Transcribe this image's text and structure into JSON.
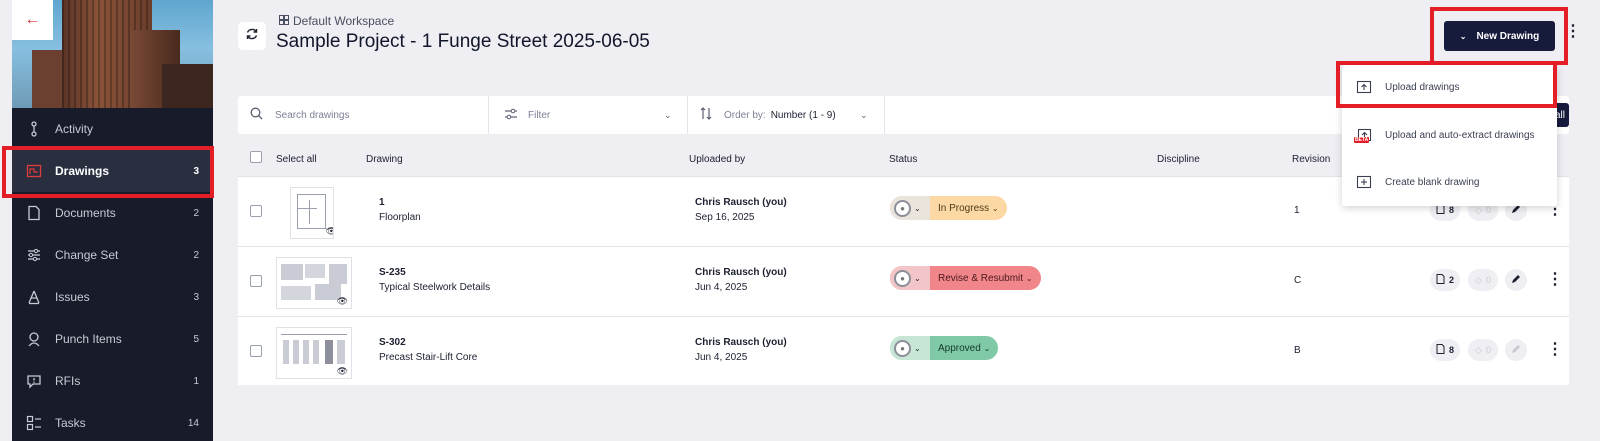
{
  "sidebar": {
    "back_icon": "arrow-left-icon",
    "items": [
      {
        "label": "Activity",
        "count": "",
        "icon": "activity-icon"
      },
      {
        "label": "Drawings",
        "count": "3",
        "icon": "drawings-icon",
        "active": true
      },
      {
        "label": "Documents",
        "count": "2",
        "icon": "document-icon"
      },
      {
        "label": "Change Set",
        "count": "2",
        "icon": "change-set-icon"
      },
      {
        "label": "Issues",
        "count": "3",
        "icon": "issues-icon"
      },
      {
        "label": "Punch Items",
        "count": "5",
        "icon": "punch-icon"
      },
      {
        "label": "RFIs",
        "count": "1",
        "icon": "rfi-icon"
      },
      {
        "label": "Tasks",
        "count": "14",
        "icon": "tasks-icon"
      }
    ]
  },
  "header": {
    "workspace": "Default Workspace",
    "title": "Sample Project - 1 Funge Street 2025-06-05",
    "new_drawing_label": "New Drawing"
  },
  "toolbar": {
    "search_placeholder": "Search drawings",
    "filter_label": "Filter",
    "order_label": "Order by:",
    "order_value": "Number (1 - 9)",
    "all_button_label": "all"
  },
  "table": {
    "select_all": "Select all",
    "columns": {
      "drawing": "Drawing",
      "uploaded_by": "Uploaded by",
      "status": "Status",
      "discipline": "Discipline",
      "revision": "Revision"
    },
    "rows": [
      {
        "number": "1",
        "name": "Floorplan",
        "uploader": "Chris Rausch (you)",
        "date": "Sep 16, 2025",
        "status": "In Progress",
        "revision": "1",
        "files": "8",
        "tags": "0"
      },
      {
        "number": "S-235",
        "name": "Typical Steelwork Details",
        "uploader": "Chris Rausch (you)",
        "date": "Jun 4, 2025",
        "status": "Revise & Resubmit",
        "revision": "C",
        "files": "2",
        "tags": "0"
      },
      {
        "number": "S-302",
        "name": "Precast Stair-Lift Core",
        "uploader": "Chris Rausch (you)",
        "date": "Jun 4, 2025",
        "status": "Approved",
        "revision": "B",
        "files": "8",
        "tags": "0"
      }
    ]
  },
  "dropdown": {
    "items": [
      {
        "label": "Upload drawings",
        "icon": "upload-icon"
      },
      {
        "label": "Upload and auto-extract drawings",
        "icon": "auto-extract-icon",
        "badge": "BETA"
      },
      {
        "label": "Create blank drawing",
        "icon": "blank-drawing-icon"
      }
    ]
  },
  "colors": {
    "sidebar_bg": "#171b2a",
    "primary_button": "#161b3c",
    "highlight": "#e41e26",
    "status_in_progress": "#fcd9a4",
    "status_revise": "#f0858a",
    "status_approved": "#7fc9a6"
  }
}
